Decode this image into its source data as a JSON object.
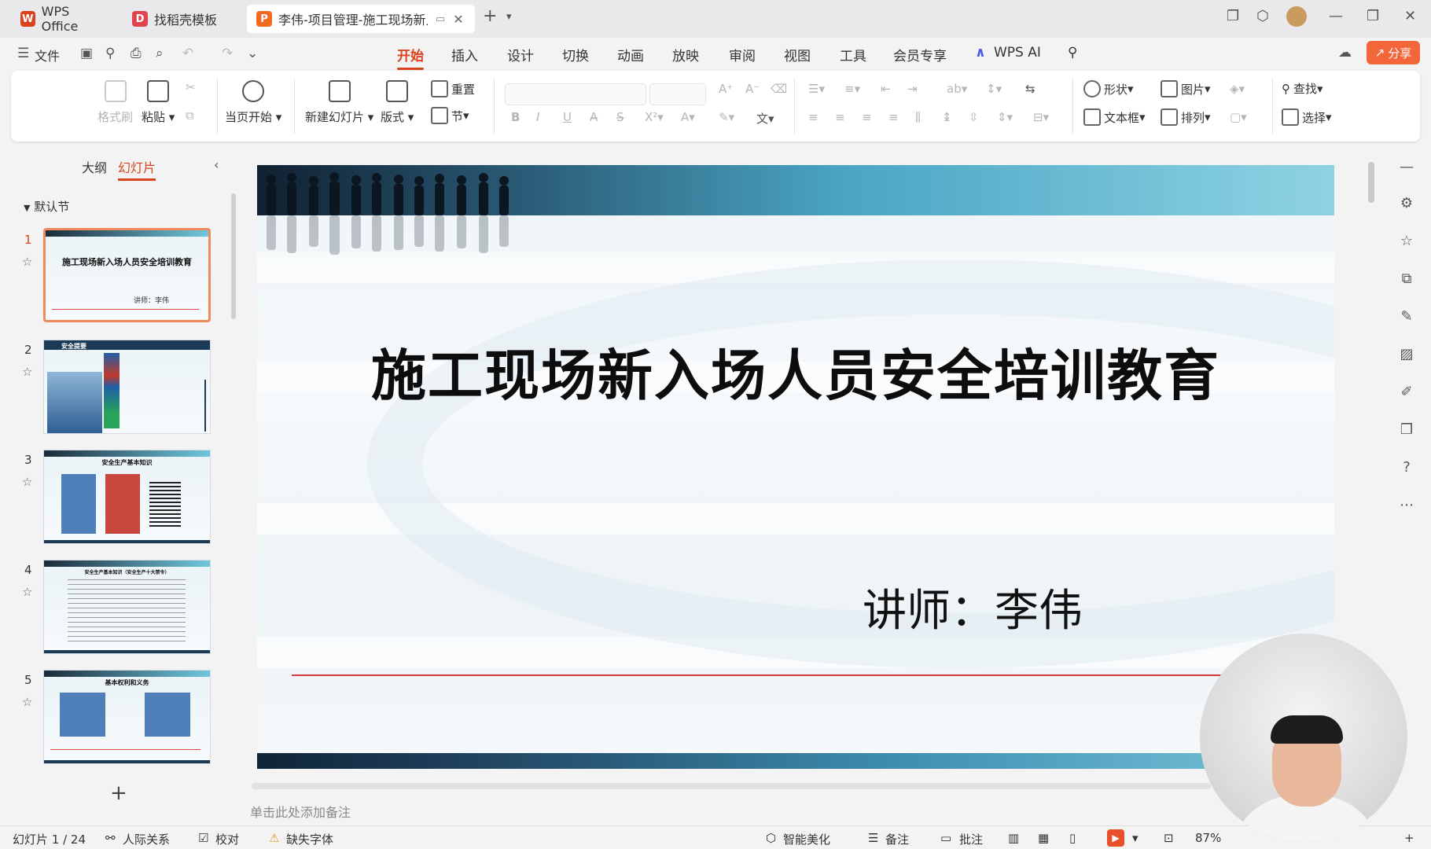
{
  "titlebar": {
    "tabs": [
      {
        "label": "WPS Office",
        "logo": "W",
        "logo_color": "#d9431f"
      },
      {
        "label": "找稻壳模板",
        "logo": "D",
        "logo_color": "#e0454f"
      },
      {
        "label": "李伟-项目管理-施工现场新入",
        "logo": "P",
        "logo_color": "#f06a22",
        "active": true
      }
    ],
    "new_tab": "+"
  },
  "menubar": {
    "file_label": "文件",
    "items": [
      "开始",
      "插入",
      "设计",
      "切换",
      "动画",
      "放映",
      "审阅",
      "视图",
      "工具",
      "会员专享",
      "WPS AI"
    ],
    "active_index": 0,
    "share_label": "分享",
    "accent": "#d9431f"
  },
  "ribbon": {
    "format_painter": "格式刷",
    "paste": "粘贴",
    "from_current": "当页开始",
    "new_slide": "新建幻灯片",
    "layout": "版式",
    "reset": "重置",
    "section": "节",
    "shape": "形状",
    "picture": "图片",
    "find": "查找",
    "textbox": "文本框",
    "arrange": "排列",
    "select": "选择"
  },
  "leftpanel": {
    "tab_outline": "大纲",
    "tab_slides": "幻灯片",
    "section": "默认节",
    "slides": [
      {
        "num": "1",
        "title": "施工现场新入场人员安全培训教育",
        "sub": "讲师：李伟"
      },
      {
        "num": "2",
        "title": "安全提要"
      },
      {
        "num": "3",
        "title": "安全生产基本知识"
      },
      {
        "num": "4",
        "title": "安全生产基本知识（安全生产十大禁令）"
      },
      {
        "num": "5",
        "title": "基本权利和义务"
      }
    ]
  },
  "slide": {
    "title": "施工现场新入场人员安全培训教育",
    "lecturer": "讲师：李伟"
  },
  "notes": {
    "placeholder": "单击此处添加备注"
  },
  "statusbar": {
    "slide_counter": "幻灯片 1 / 24",
    "relations": "人际关系",
    "proof": "校对",
    "missing_font": "缺失字体",
    "beautify": "智能美化",
    "notes": "备注",
    "comments": "批注",
    "zoom": "87%"
  }
}
